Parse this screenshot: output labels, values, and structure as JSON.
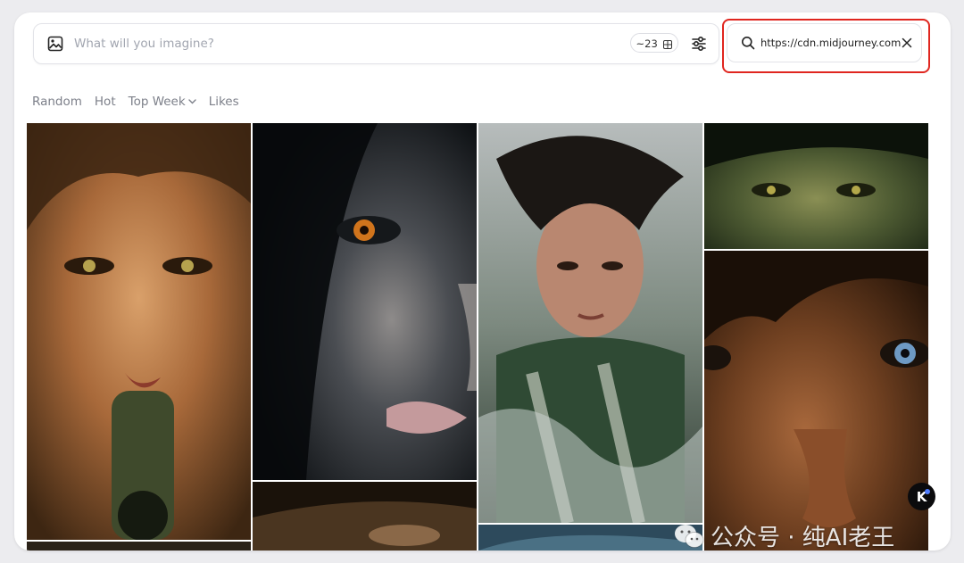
{
  "prompt_bar": {
    "placeholder": "What will you imagine?",
    "aspect_chip": "~23"
  },
  "search": {
    "value": "https://cdn.midjourney.com"
  },
  "filters": [
    {
      "label": "Random"
    },
    {
      "label": "Hot"
    },
    {
      "label": "Top Week"
    },
    {
      "label": "Likes"
    }
  ],
  "watermark": {
    "text": "公众号 · 纯AI老王"
  },
  "logo": {
    "letter": "K"
  },
  "colors": {
    "highlight": "#e0261f",
    "placeholder": "#a2a6b0",
    "filter_text": "#7d808a",
    "badge_dot": "#4f7cff"
  },
  "icons": [
    "image-icon",
    "grid-icon",
    "sliders-icon",
    "search-icon",
    "close-icon",
    "chevron-down-icon",
    "wechat-icon"
  ]
}
